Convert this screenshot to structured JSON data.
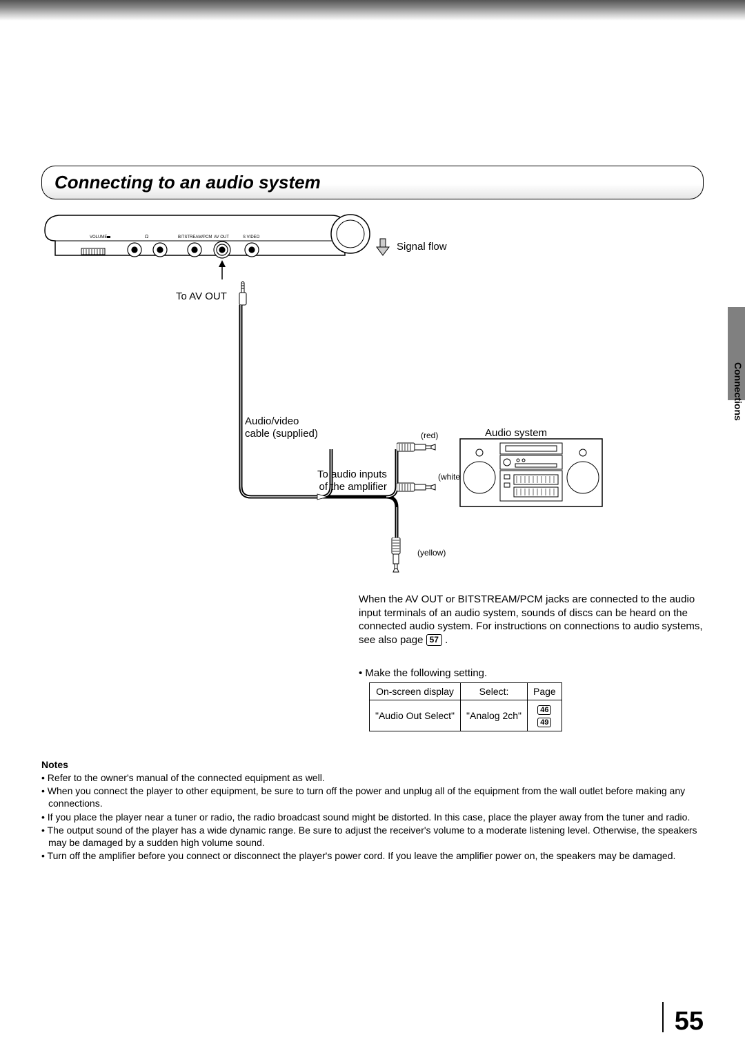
{
  "section_title": "Connecting to an audio system",
  "side_tab": "Connections",
  "diagram": {
    "signal_flow": "Signal flow",
    "to_av_out": "To  AV OUT",
    "av_cable": "Audio/video\ncable (supplied)",
    "to_audio_inputs": "To audio inputs\nof the amplifier",
    "red": "(red)",
    "white": "(white)",
    "yellow": "(yellow)",
    "audio_system": "Audio system",
    "port_labels": {
      "volume": "VOLUME",
      "headphone": "",
      "bitstream": "BITSTREAM/PCM",
      "avout": "AV OUT",
      "svideo": "S VIDEO"
    }
  },
  "description": {
    "text_before": "When the AV OUT or BITSTREAM/PCM jacks are connected to the audio input terminals of an audio system, sounds of discs can be heard on the connected audio system. For instructions on connections to audio systems, see also page ",
    "page_ref": "57",
    "text_after": " ."
  },
  "setting_intro": "•  Make the following setting.",
  "settings_table": {
    "headers": [
      "On-screen display",
      "Select:",
      "Page"
    ],
    "row": {
      "onscreen": "\"Audio Out Select\"",
      "select": "\"Analog 2ch\"",
      "pages": [
        "46",
        "49"
      ]
    }
  },
  "notes_heading": "Notes",
  "notes": [
    "Refer to the owner's manual of the connected equipment as well.",
    "When you connect the player to other equipment, be sure to turn off the power and unplug all of the equipment from the wall outlet before making any connections.",
    "If you place the player near a tuner or radio, the radio broadcast sound might be distorted. In this case, place the player away from the tuner and radio.",
    "The output sound of the player has a wide dynamic range. Be sure to adjust the receiver's volume to a moderate listening level. Otherwise, the speakers may be damaged by a sudden high volume sound.",
    "Turn off the amplifier before you connect or disconnect the player's power cord. If you leave the amplifier power on, the speakers may be damaged."
  ],
  "page_number": "55"
}
